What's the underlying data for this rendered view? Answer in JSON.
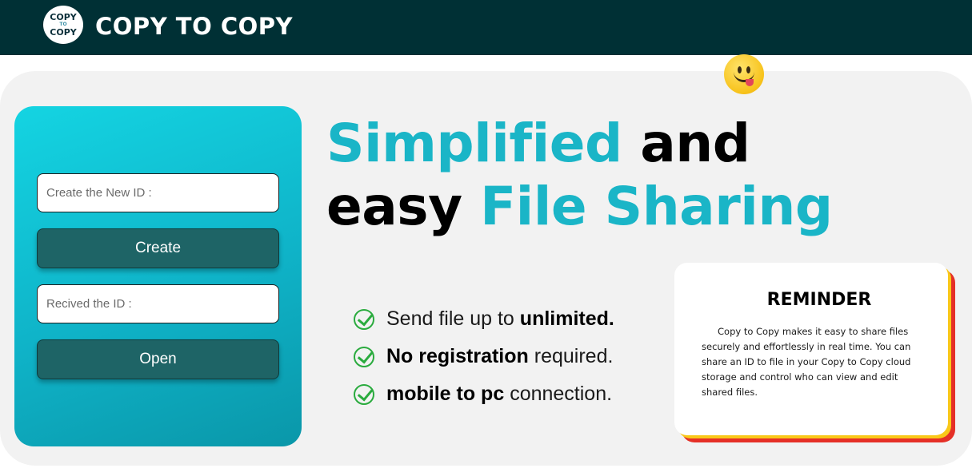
{
  "header": {
    "logo": {
      "top": "COPY",
      "mid": "TO",
      "bottom": "COPY"
    },
    "brand_name": "COPY TO COPY",
    "background_color": "#003035"
  },
  "emoji": {
    "icon": "tongue-out-smiley-icon"
  },
  "form_panel": {
    "new_id_placeholder": "Create the New ID :",
    "new_id_value": "",
    "create_label": "Create",
    "received_id_placeholder": "Recived the ID :",
    "received_id_value": "",
    "open_label": "Open"
  },
  "hero": {
    "line1_accent": "Simplified",
    "line1_rest": " and",
    "line2_start": "easy ",
    "line2_accent": "File Sharing",
    "accent_color": "#1ab5c7"
  },
  "features": [
    {
      "icon": "check-circle-icon",
      "pre": "Send file up to ",
      "bold": "unlimited.",
      "post": ""
    },
    {
      "icon": "check-circle-icon",
      "pre": "",
      "bold": "No registration",
      "post": " required."
    },
    {
      "icon": "check-circle-icon",
      "pre": "",
      "bold": "mobile to pc",
      "post": " connection."
    }
  ],
  "reminder": {
    "title": "REMINDER",
    "body": "Copy to Copy makes it easy to share files securely and effortlessly in real time. You can share an ID to file in your Copy to Copy cloud storage and control who can view and edit shared files."
  }
}
